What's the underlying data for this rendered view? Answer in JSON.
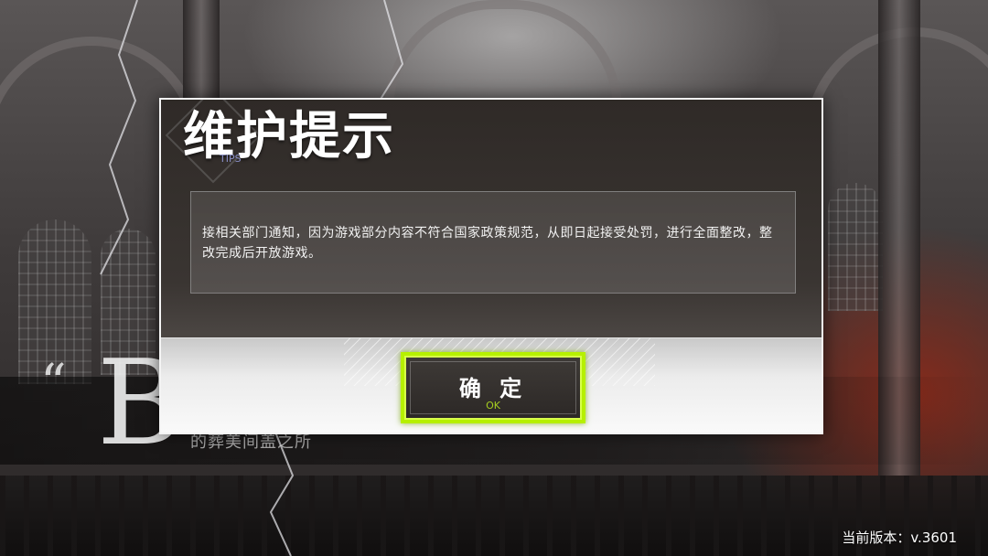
{
  "background": {
    "subtitle_text": "的葬美间盖之所"
  },
  "dialog": {
    "title": "维护提示",
    "subtitle": "TIPS",
    "message": "接相关部门通知，因为游戏部分内容不符合国家政策规范，从即日起接受处罚，进行全面整改，整改完成后开放游戏。",
    "ok_label": "确 定",
    "ok_sublabel": "OK"
  },
  "version": {
    "label": "当前版本：",
    "value": "v.3601"
  },
  "colors": {
    "button_accent": "#b6f000",
    "dialog_border": "#f4f4f4",
    "subtitle_color": "#8a90c8"
  }
}
